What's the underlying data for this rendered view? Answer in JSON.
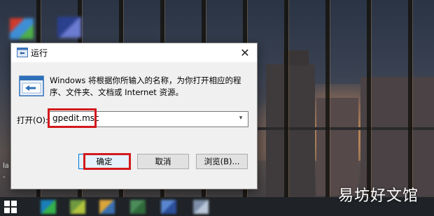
{
  "dialog": {
    "title": "运行",
    "description": "Windows 将根据你所输入的名称，为你打开相应的程序、文件夹、文档或 Internet 资源。",
    "open_label": "打开(O):",
    "command_value": "gpedit.msc",
    "buttons": {
      "ok": "确定",
      "cancel": "取消",
      "browse": "浏览(B)..."
    },
    "close_glyph": "✕",
    "dropdown_glyph": "▾"
  },
  "desktop": {
    "partial_label_1": "la",
    "partial_label_2": "-"
  },
  "watermark": "易坊好文馆",
  "colors": {
    "highlight": "#d3191c",
    "accent": "#0078d7",
    "dialog_bg": "#f0f0f0",
    "taskbar_bg": "#1f2226"
  },
  "icons": {
    "run": "run-dialog-icon",
    "close": "close-icon",
    "dropdown": "chevron-down-icon",
    "start": "windows-start-icon"
  }
}
